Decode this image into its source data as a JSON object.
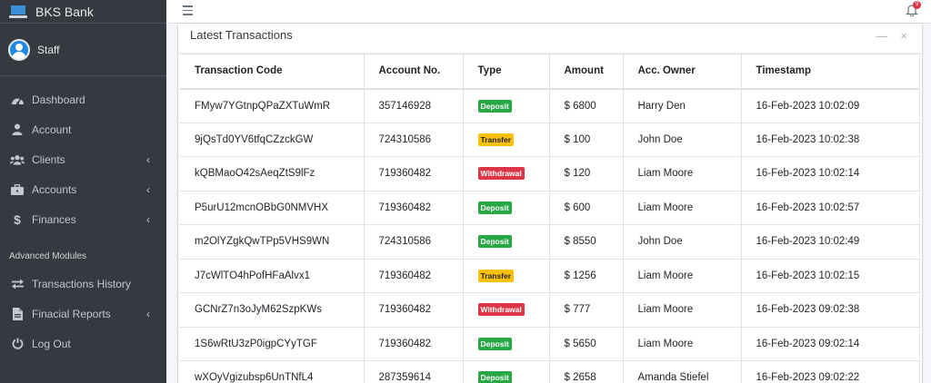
{
  "app": {
    "brand": "BKS Bank",
    "user_name": "Staff"
  },
  "sidebar": {
    "items": [
      {
        "label": "Dashboard",
        "icon": "dashboard-icon",
        "has_arrow": false
      },
      {
        "label": "Account",
        "icon": "user-icon",
        "has_arrow": false
      },
      {
        "label": "Clients",
        "icon": "users-icon",
        "has_arrow": true
      },
      {
        "label": "Accounts",
        "icon": "briefcase-icon",
        "has_arrow": true
      },
      {
        "label": "Finances",
        "icon": "dollar-icon",
        "has_arrow": true
      }
    ],
    "section_header": "Advanced Modules",
    "advanced_items": [
      {
        "label": "Transactions History",
        "icon": "exchange-icon",
        "has_arrow": false
      },
      {
        "label": "Finacial Reports",
        "icon": "file-icon",
        "has_arrow": true
      },
      {
        "label": "Log Out",
        "icon": "power-icon",
        "has_arrow": false
      }
    ],
    "arrow_glyph": "‹"
  },
  "topbar": {
    "notification_count": "9"
  },
  "card": {
    "title": "Latest Transactions",
    "minimize_glyph": "—",
    "close_glyph": "×"
  },
  "table": {
    "headers": [
      "Transaction Code",
      "Account No.",
      "Type",
      "Amount",
      "Acc. Owner",
      "Timestamp"
    ],
    "rows": [
      {
        "code": "FMyw7YGtnpQPaZXTuWmR",
        "account": "357146928",
        "type": "Deposit",
        "type_class": "deposit",
        "amount": "$ 6800",
        "owner": "Harry Den",
        "timestamp": "16-Feb-2023 10:02:09"
      },
      {
        "code": "9jQsTd0YV6tfqCZzckGW",
        "account": "724310586",
        "type": "Transfer",
        "type_class": "transfer",
        "amount": "$ 100",
        "owner": "John Doe",
        "timestamp": "16-Feb-2023 10:02:38"
      },
      {
        "code": "kQBMaoO42sAeqZtS9lFz",
        "account": "719360482",
        "type": "Withdrawal",
        "type_class": "withdrawal",
        "amount": "$ 120",
        "owner": "Liam Moore",
        "timestamp": "16-Feb-2023 10:02:14"
      },
      {
        "code": "P5urU12mcnOBbG0NMVHX",
        "account": "719360482",
        "type": "Deposit",
        "type_class": "deposit",
        "amount": "$ 600",
        "owner": "Liam Moore",
        "timestamp": "16-Feb-2023 10:02:57"
      },
      {
        "code": "m2OlYZgkQwTPp5VHS9WN",
        "account": "724310586",
        "type": "Deposit",
        "type_class": "deposit",
        "amount": "$ 8550",
        "owner": "John Doe",
        "timestamp": "16-Feb-2023 10:02:49"
      },
      {
        "code": "J7cWlTO4hPofHFaAlvx1",
        "account": "719360482",
        "type": "Transfer",
        "type_class": "transfer",
        "amount": "$ 1256",
        "owner": "Liam Moore",
        "timestamp": "16-Feb-2023 10:02:15"
      },
      {
        "code": "GCNrZ7n3oJyM62SzpKWs",
        "account": "719360482",
        "type": "Withdrawal",
        "type_class": "withdrawal",
        "amount": "$ 777",
        "owner": "Liam Moore",
        "timestamp": "16-Feb-2023 09:02:38"
      },
      {
        "code": "1S6wRtU3zP0igpCYyTGF",
        "account": "719360482",
        "type": "Deposit",
        "type_class": "deposit",
        "amount": "$ 5650",
        "owner": "Liam Moore",
        "timestamp": "16-Feb-2023 09:02:14"
      },
      {
        "code": "wXOyVgizubsp6UnTNfL4",
        "account": "287359614",
        "type": "Deposit",
        "type_class": "deposit",
        "amount": "$ 2658",
        "owner": "Amanda Stiefel",
        "timestamp": "16-Feb-2023 09:02:22"
      }
    ]
  },
  "colors": {
    "sidebar_bg": "#343a40",
    "deposit": "#28a745",
    "transfer": "#ffc107",
    "withdrawal": "#dc3545"
  }
}
